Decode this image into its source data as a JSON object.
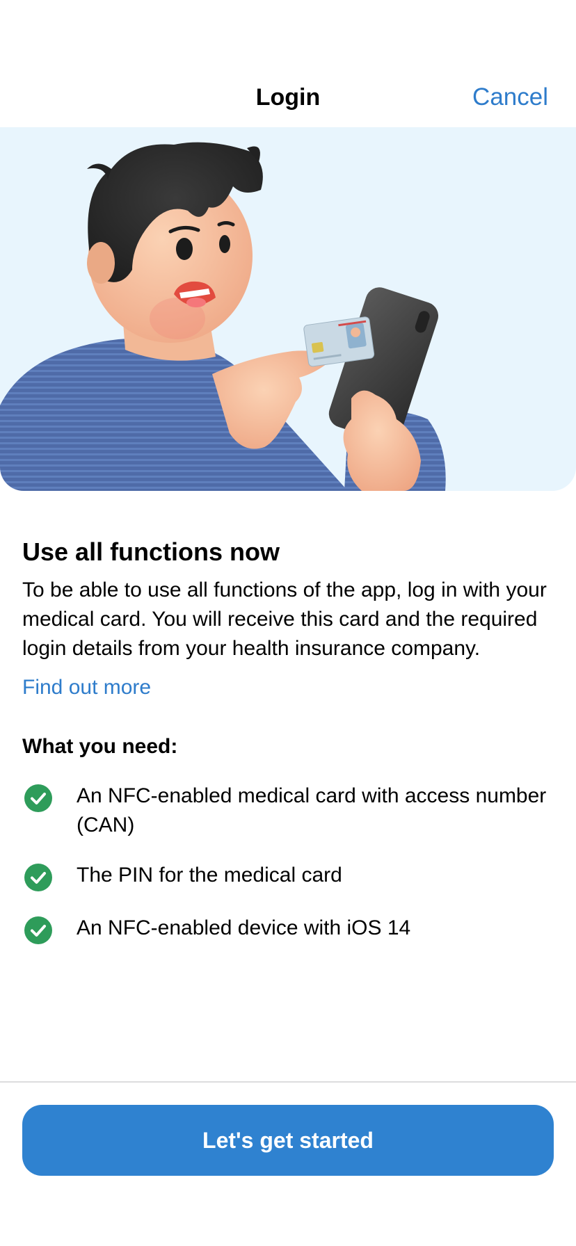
{
  "nav": {
    "title": "Login",
    "cancel_label": "Cancel"
  },
  "hero": {
    "illustration": "person-holding-medical-card-and-phone"
  },
  "intro": {
    "heading": "Use all functions now",
    "body": "To be able to use all functions of the app, log in with your medical card. You will receive this card and the required login details from your health insurance company.",
    "link_label": "Find out more"
  },
  "requirements": {
    "heading": "What you need:",
    "items": [
      {
        "label": "An NFC-enabled medical card with access number (CAN)",
        "icon": "check-circle-icon"
      },
      {
        "label": "The PIN for the medical card",
        "icon": "check-circle-icon"
      },
      {
        "label": "An NFC-enabled device with iOS 14",
        "icon": "check-circle-icon"
      }
    ]
  },
  "footer": {
    "cta_label": "Let's get started"
  },
  "colors": {
    "accent": "#2e7ccb",
    "button": "#2f82d0",
    "check": "#2e9c5a",
    "hero_background": "#e8f5fd"
  }
}
